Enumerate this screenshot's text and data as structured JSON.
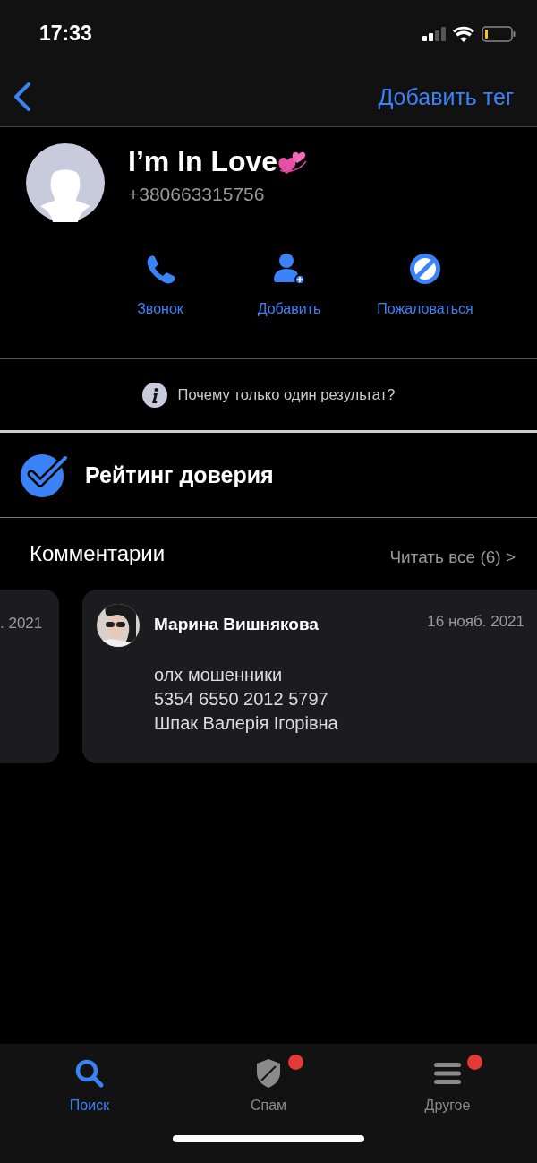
{
  "status_bar": {
    "time": "17:33"
  },
  "nav": {
    "action": "Добавить тег"
  },
  "contact": {
    "name": "I’m In Love",
    "phone": "+380663315756"
  },
  "actions": [
    {
      "kind": "call",
      "label": "Звонок"
    },
    {
      "kind": "add",
      "label": "Добавить"
    },
    {
      "kind": "report",
      "label": "Пожаловаться"
    }
  ],
  "info": {
    "text": "Почему только один результат?"
  },
  "trust": {
    "title": "Рейтинг доверия"
  },
  "comments": {
    "title": "Комментарии",
    "read_all": "Читать все (6) >",
    "items": [
      {
        "date": ". 2021"
      },
      {
        "author": "Марина Вишнякова",
        "date": "16 нояб. 2021",
        "lines": [
          "олх мошенники",
          "5354 6550 2012 5797",
          "Шпак Валерія Ігорівна"
        ]
      }
    ]
  },
  "tabs": [
    {
      "kind": "search",
      "label": "Поиск",
      "selected": true,
      "badge": false
    },
    {
      "kind": "spam",
      "label": "Спам",
      "selected": false,
      "badge": true
    },
    {
      "kind": "other",
      "label": "Другое",
      "selected": false,
      "badge": true
    }
  ]
}
